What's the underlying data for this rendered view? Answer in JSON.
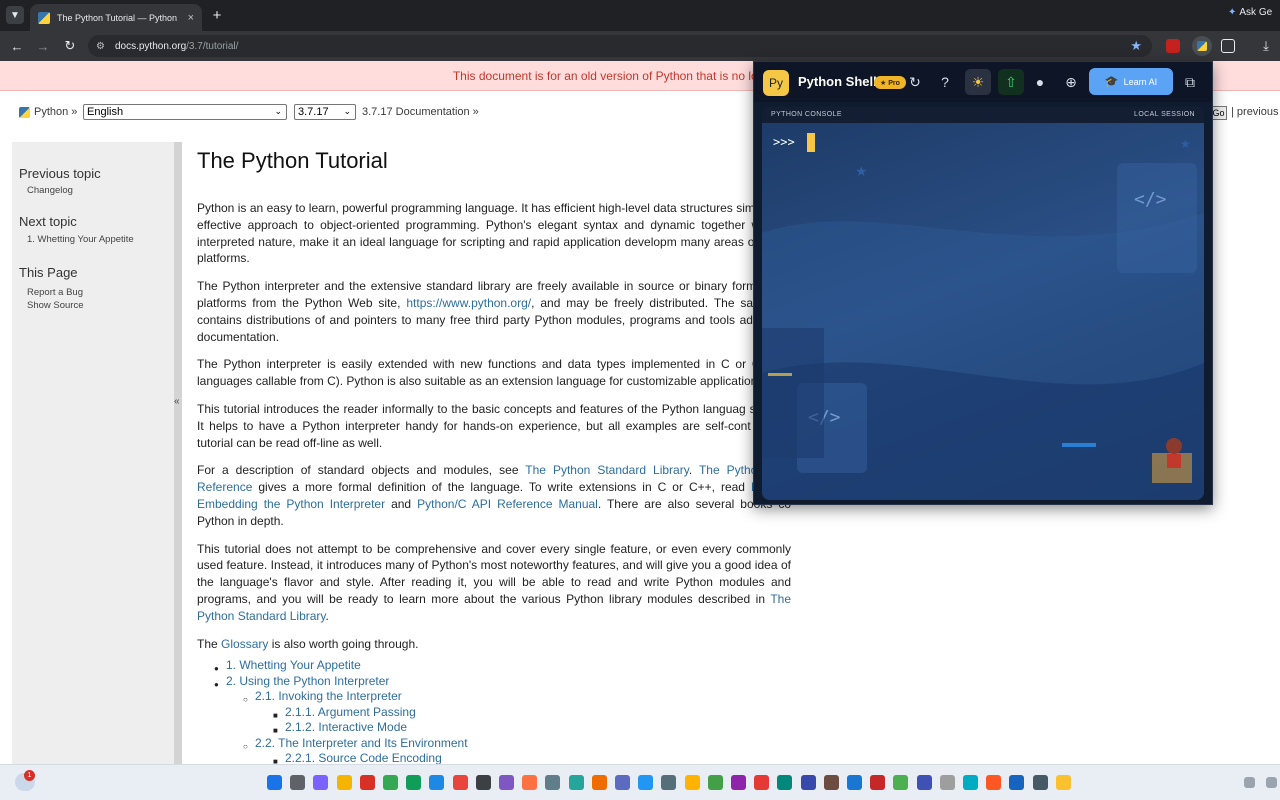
{
  "browser": {
    "tab_title": "The Python Tutorial — Python",
    "tab_close": "×",
    "new_tab": "+",
    "ask_gemini": "Ask Ge",
    "url_host": "docs.python.org",
    "url_path": "/3.7/tutorial/"
  },
  "page": {
    "banner": "This document is for an old version of Python that is no longer supported. You should upg",
    "breadcrumb_python": "Python »",
    "language_select": "English",
    "version_select": "3.7.17",
    "doc_crumb": "3.7.17 Documentation »",
    "go_button": "Go",
    "previous_link": "| previous"
  },
  "sidebar": {
    "previous_topic_heading": "Previous topic",
    "previous_topic_link": "Changelog",
    "next_topic_heading": "Next topic",
    "next_topic_link": "1. Whetting Your Appetite",
    "this_page_heading": "This Page",
    "report_bug": "Report a Bug",
    "show_source": "Show Source",
    "collapse": "«"
  },
  "content": {
    "title": "The Python Tutorial",
    "p1": "Python is an easy to learn, powerful programming language. It has efficient high-level data structures simple but effective approach to object-oriented programming. Python's elegant syntax and dynamic together with its interpreted nature, make it an ideal language for scripting and rapid application developm many areas on most platforms.",
    "p2_a": "The Python interpreter and the extensive standard library are freely available in source or binary form major platforms from the Python Web site, ",
    "p2_link": "https://www.python.org/",
    "p2_b": ", and may be freely distributed. The sam also contains distributions of and pointers to many free third party Python modules, programs and tools additional documentation.",
    "p3": "The Python interpreter is easily extended with new functions and data types implemented in C or C++ (o languages callable from C). Python is also suitable as an extension language for customizable applications",
    "p4": "This tutorial introduces the reader informally to the basic concepts and features of the Python languag system. It helps to have a Python interpreter handy for hands-on experience, but all examples are self-cont so the tutorial can be read off-line as well.",
    "p5_a": "For a description of standard objects and modules, see ",
    "p5_link1": "The Python Standard Library",
    "p5_b": ". ",
    "p5_link2": "The Python Lan Reference",
    "p5_c": " gives a more formal definition of the language. To write extensions in C or C++, read ",
    "p5_link3": "Extendi Embedding the Python Interpreter",
    "p5_d": " and ",
    "p5_link4": "Python/C API Reference Manual",
    "p5_e": ". There are also several books co Python in depth.",
    "p6_a": "This tutorial does not attempt to be comprehensive and cover every single feature, or even every commonly used feature. Instead, it introduces many of Python's most noteworthy features, and will give you a good idea of the language's flavor and style. After reading it, you will be able to read and write Python modules and programs, and you will be ready to learn more about the various Python library modules described in ",
    "p6_link": "The Python Standard Library",
    "p6_b": ".",
    "p7_a": "The ",
    "p7_link": "Glossary",
    "p7_b": " is also worth going through."
  },
  "toc": [
    {
      "label": "1. Whetting Your Appetite",
      "level": 1
    },
    {
      "label": "2. Using the Python Interpreter",
      "level": 1
    },
    {
      "label": "2.1. Invoking the Interpreter",
      "level": 2
    },
    {
      "label": "2.1.1. Argument Passing",
      "level": 3
    },
    {
      "label": "2.1.2. Interactive Mode",
      "level": 3
    },
    {
      "label": "2.2. The Interpreter and Its Environment",
      "level": 2
    },
    {
      "label": "2.2.1. Source Code Encoding",
      "level": 3
    }
  ],
  "shell": {
    "badge": "Py",
    "title": "Python Shell",
    "pro": "★ Pro",
    "learn_ai": "Learn AI",
    "console_label": "PYTHON CONSOLE",
    "session_label": "LOCAL SESSION",
    "prompt": ">>>"
  },
  "taskbar": {
    "weather_badge": "1"
  },
  "colors": {
    "accent_link": "#2d6e9f",
    "banner_bg": "#ffdddd",
    "shell_yellow": "#f6c744",
    "learn_ai_blue": "#5ba4f5"
  }
}
